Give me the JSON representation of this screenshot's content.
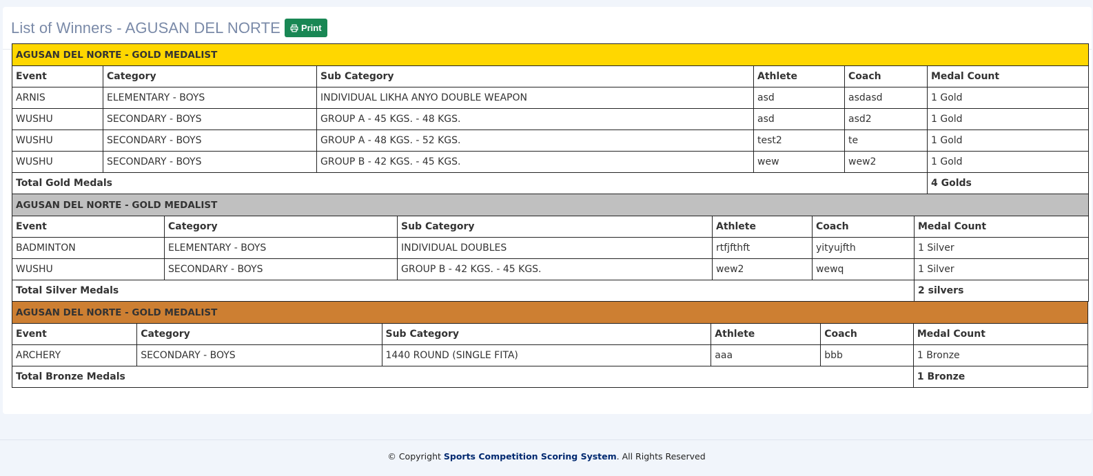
{
  "header": {
    "title": "List of Winners - AGUSAN DEL NORTE",
    "print_label": "Print",
    "print_icon": "printer-icon",
    "print_color": "#198754"
  },
  "gold": {
    "title": "AGUSAN DEL NORTE - GOLD MEDALIST",
    "color": "#ffd700",
    "headers": [
      "Event",
      "Category",
      "Sub Category",
      "Athlete",
      "Coach",
      "Medal Count"
    ],
    "rows": [
      [
        "ARNIS",
        "ELEMENTARY - BOYS",
        "INDIVIDUAL LIKHA ANYO DOUBLE WEAPON",
        "asd",
        "asdasd",
        "1 Gold"
      ],
      [
        "WUSHU",
        "SECONDARY - BOYS",
        "GROUP A - 45 KGS. - 48 KGS.",
        "asd",
        "asd2",
        "1 Gold"
      ],
      [
        "WUSHU",
        "SECONDARY - BOYS",
        "GROUP A - 48 KGS. - 52 KGS.",
        "test2",
        "te",
        "1 Gold"
      ],
      [
        "WUSHU",
        "SECONDARY - BOYS",
        "GROUP B - 42 KGS. - 45 KGS.",
        "wew",
        "wew2",
        "1 Gold"
      ]
    ],
    "total_label": "Total Gold Medals",
    "total_value": "4 Golds"
  },
  "silver": {
    "title": "AGUSAN DEL NORTE - GOLD MEDALIST",
    "color": "#c0c0c0",
    "headers": [
      "Event",
      "Category",
      "Sub Category",
      "Athlete",
      "Coach",
      "Medal Count"
    ],
    "rows": [
      [
        "BADMINTON",
        "ELEMENTARY - BOYS",
        "INDIVIDUAL DOUBLES",
        "rtfjfthft",
        "yityujfth",
        "1 Silver"
      ],
      [
        "WUSHU",
        "SECONDARY - BOYS",
        "GROUP B - 42 KGS. - 45 KGS.",
        "wew2",
        "wewq",
        "1 Silver"
      ]
    ],
    "total_label": "Total Silver Medals",
    "total_value": "2 silvers"
  },
  "bronze": {
    "title": "AGUSAN DEL NORTE - GOLD MEDALIST",
    "color": "#cd7f32",
    "headers": [
      "Event",
      "Category",
      "Sub Category",
      "Athlete",
      "Coach",
      "Medal Count"
    ],
    "rows": [
      [
        "ARCHERY",
        "SECONDARY - BOYS",
        "1440 ROUND (SINGLE FITA)",
        "aaa",
        "bbb",
        "1 Bronze"
      ]
    ],
    "total_label": "Total Bronze Medals",
    "total_value": "1 Bronze"
  },
  "footer": {
    "prefix": "© Copyright ",
    "brand": "Sports Competition Scoring System",
    "suffix": ". All Rights Reserved"
  }
}
